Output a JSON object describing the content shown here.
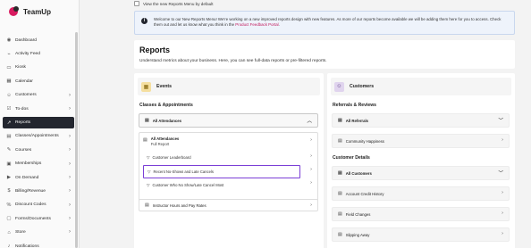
{
  "brand": {
    "name": "TeamUp"
  },
  "sidebar": {
    "items": [
      {
        "label": "Dashboard",
        "icon": "◉",
        "chevron": false,
        "active": false
      },
      {
        "label": "Activity Feed",
        "icon": "⌁",
        "chevron": false,
        "active": false
      },
      {
        "label": "Kiosk",
        "icon": "▭",
        "chevron": false,
        "active": false
      },
      {
        "label": "Calendar",
        "icon": "▦",
        "chevron": false,
        "active": false
      },
      {
        "label": "Customers",
        "icon": "☺",
        "chevron": true,
        "active": false
      },
      {
        "label": "To-dos",
        "icon": "☑",
        "chevron": true,
        "active": false
      },
      {
        "label": "Reports",
        "icon": "↗",
        "chevron": false,
        "active": true
      },
      {
        "label": "Classes/Appointments",
        "icon": "▤",
        "chevron": true,
        "active": false
      },
      {
        "label": "Courses",
        "icon": "✎",
        "chevron": true,
        "active": false
      },
      {
        "label": "Memberships",
        "icon": "▣",
        "chevron": true,
        "active": false
      },
      {
        "label": "On Demand",
        "icon": "▶",
        "chevron": true,
        "active": false
      },
      {
        "label": "Billing/Revenue",
        "icon": "$",
        "chevron": true,
        "active": false
      },
      {
        "label": "Discount Codes",
        "icon": "%",
        "chevron": true,
        "active": false
      },
      {
        "label": "Forms/Documents",
        "icon": "▢",
        "chevron": true,
        "active": false
      },
      {
        "label": "Store",
        "icon": "⌂",
        "chevron": true,
        "active": false
      },
      {
        "label": "Notifications",
        "icon": "♪",
        "chevron": false,
        "active": false
      }
    ]
  },
  "topbar": {
    "checkbox_label": "View the new Reports Menu by default"
  },
  "banner": {
    "text": "Welcome to our New Reports Menu! We're working on a new improved reports design with new features. As more of our reports become available we will be adding them here for you to access. Check them out and let us know what you think in the ",
    "link": "Product Feedback Portal",
    "tail": "."
  },
  "header": {
    "title": "Reports",
    "subtitle": "Understand metrics about your business. Here, you can see full-data reports or pre-filtered reports."
  },
  "events": {
    "title": "Events",
    "section": "Classes & Appointments",
    "all_attendances": "All Attendances",
    "dropdown_head_title": "All Attendances",
    "dropdown_head_sub": "Full Report",
    "sub_items": [
      "Customer Leaderboard",
      "Recent No-Shows and Late Cancels",
      "Customer Who No Show/Late Cancel Most"
    ],
    "instructor": "Instructor Hours and Pay Rates"
  },
  "customers": {
    "title": "Customers",
    "section_referrals": "Referrals & Reviews",
    "all_referrals": "All Referrals",
    "community": "Community Happiness",
    "section_details": "Customer Details",
    "all_customers": "All Customers",
    "account_credit": "Account Credit History",
    "field_changes": "Field Changes",
    "slipping_away": "Slipping Away"
  }
}
